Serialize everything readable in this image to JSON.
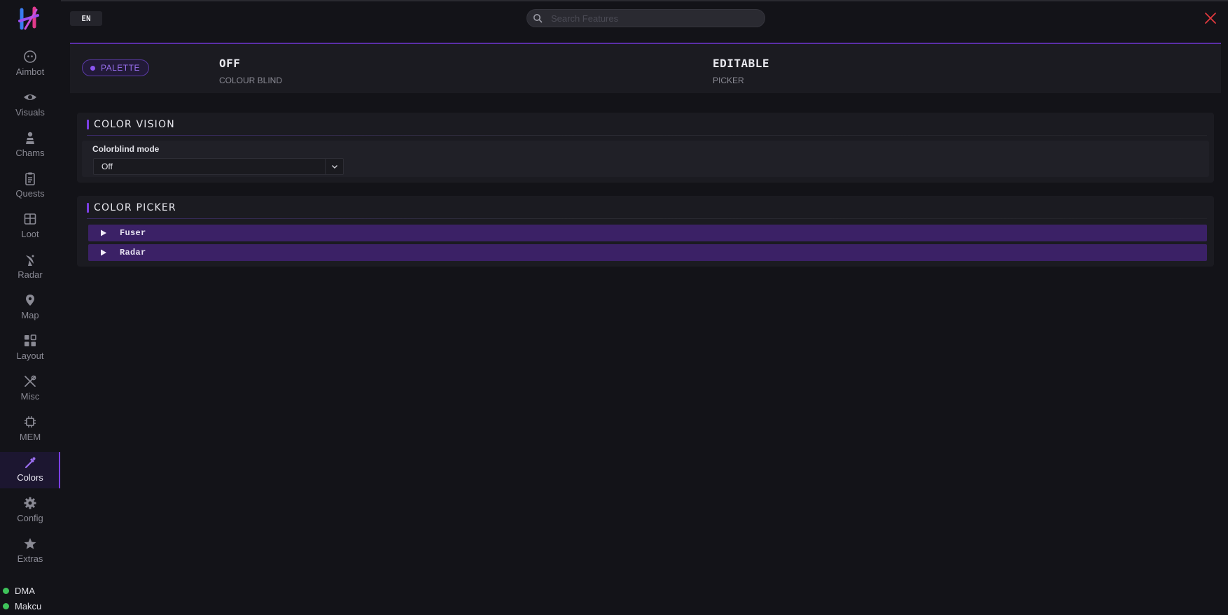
{
  "sidebar": {
    "items": [
      {
        "label": "Aimbot",
        "icon": "aimbot-icon"
      },
      {
        "label": "Visuals",
        "icon": "eye-icon"
      },
      {
        "label": "Chams",
        "icon": "chams-icon"
      },
      {
        "label": "Quests",
        "icon": "clipboard-icon"
      },
      {
        "label": "Loot",
        "icon": "loot-box-icon"
      },
      {
        "label": "Radar",
        "icon": "radar-dish-icon"
      },
      {
        "label": "Map",
        "icon": "map-pin-icon"
      },
      {
        "label": "Layout",
        "icon": "layout-grid-icon"
      },
      {
        "label": "Misc",
        "icon": "tools-icon"
      },
      {
        "label": "MEM",
        "icon": "chip-icon"
      },
      {
        "label": "Colors",
        "icon": "pipette-icon",
        "active": true
      },
      {
        "label": "Config",
        "icon": "gear-icon"
      },
      {
        "label": "Extras",
        "icon": "star-icon"
      }
    ],
    "status": [
      {
        "label": "DMA",
        "color": "#3ec35a"
      },
      {
        "label": "Makcu",
        "color": "#3ec35a"
      }
    ]
  },
  "topbar": {
    "language": "EN",
    "search_placeholder": "Search Features"
  },
  "header": {
    "pill_label": "PALETTE",
    "stats": [
      {
        "value": "OFF",
        "label": "COLOUR BLIND"
      },
      {
        "value": "EDITABLE",
        "label": "PICKER"
      }
    ]
  },
  "color_vision": {
    "title": "COLOR VISION",
    "field_label": "Colorblind mode",
    "selected": "Off"
  },
  "color_picker": {
    "title": "COLOR PICKER",
    "items": [
      "Fuser",
      "Radar"
    ]
  },
  "colors": {
    "accent": "#7b3fe4",
    "status_ok": "#3ec35a",
    "close": "#e0393e"
  }
}
